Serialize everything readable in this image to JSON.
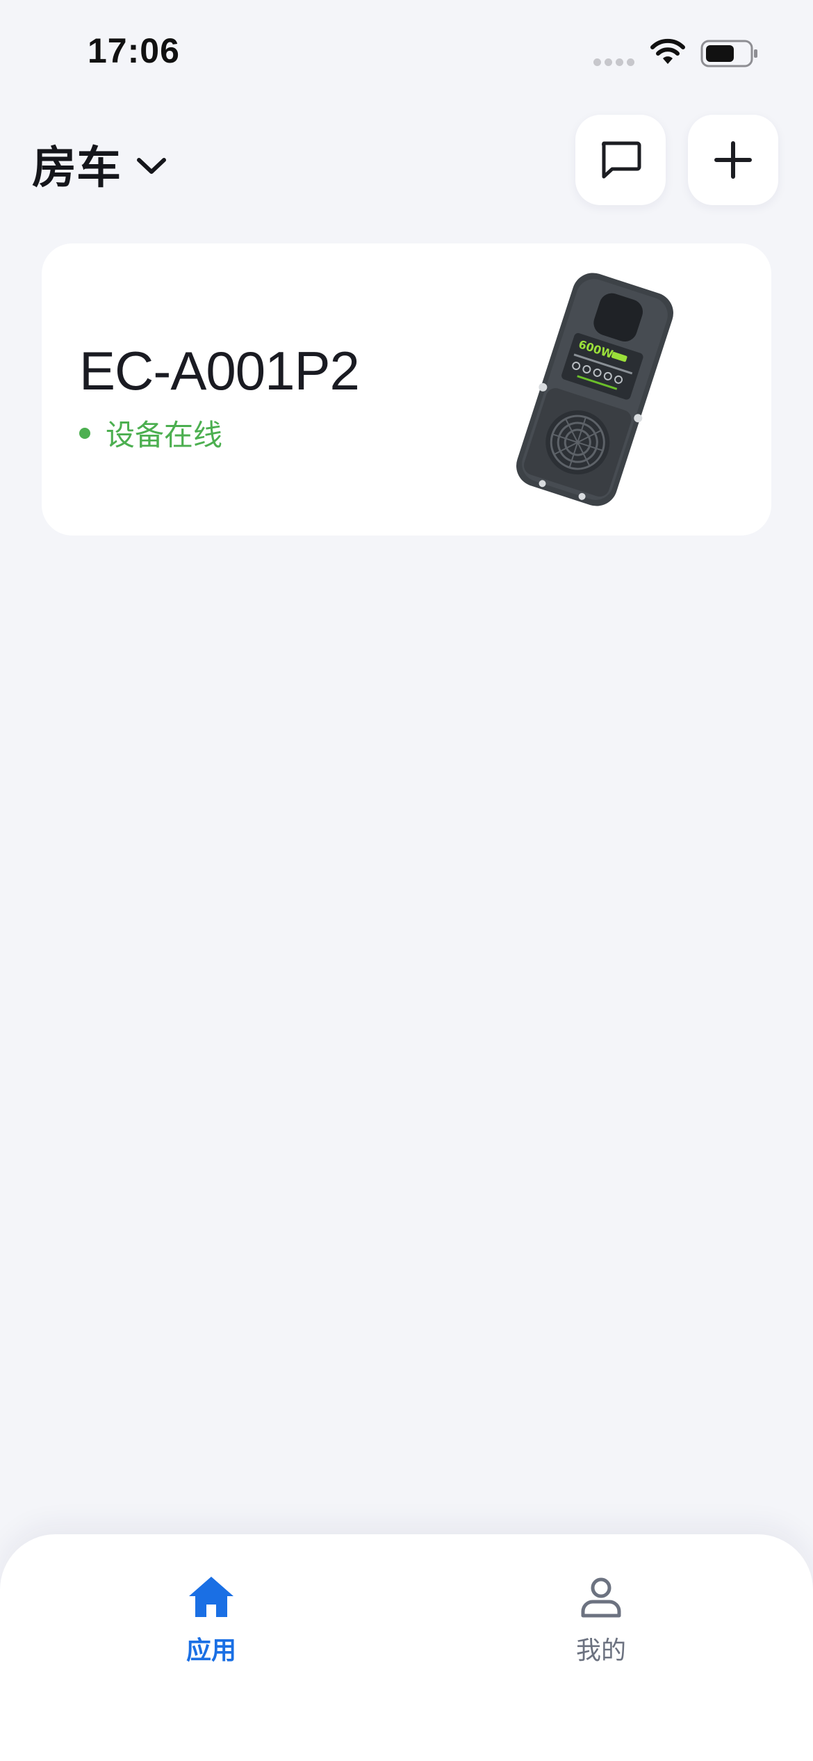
{
  "status_bar": {
    "time": "17:06",
    "icons": [
      "signal-icon",
      "wifi-icon",
      "battery-icon"
    ]
  },
  "header": {
    "home_name": "房车",
    "selector_icon": "chevron-down-icon",
    "buttons": [
      {
        "name": "message-button",
        "icon": "message-icon"
      },
      {
        "name": "add-button",
        "icon": "plus-icon"
      }
    ]
  },
  "devices": [
    {
      "name": "EC-A001P2",
      "status": "设备在线",
      "image_label": "600W",
      "status_color": "#4caf50"
    }
  ],
  "tab_bar": {
    "tabs": [
      {
        "label": "应用",
        "icon": "home-icon",
        "active": true
      },
      {
        "label": "我的",
        "icon": "person-icon",
        "active": false
      }
    ]
  },
  "colors": {
    "background": "#f4f5f9",
    "accent": "#1a6fe4",
    "online": "#4caf50",
    "inactive": "#6c7280"
  }
}
